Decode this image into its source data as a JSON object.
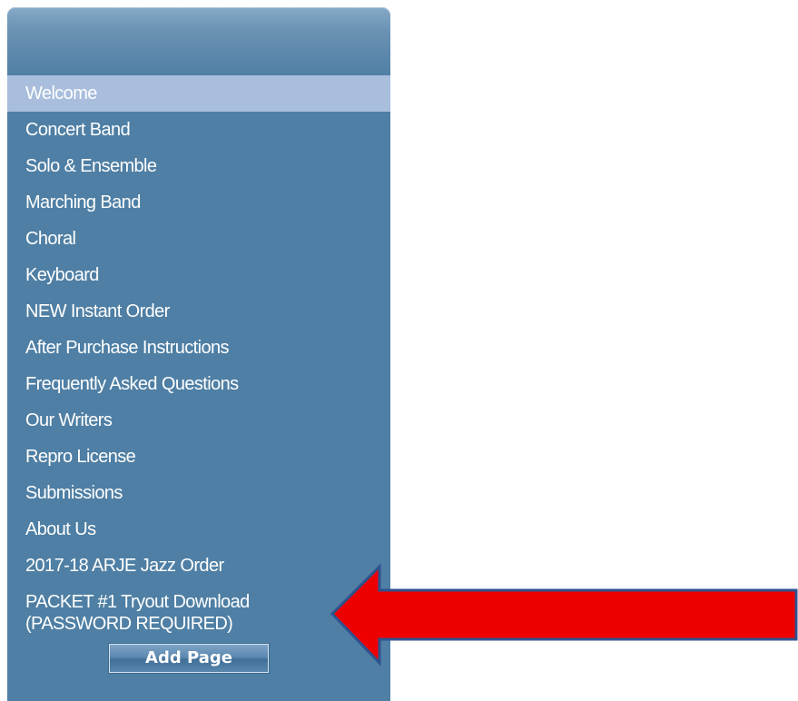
{
  "nav": {
    "items": [
      {
        "label": "Welcome",
        "active": true
      },
      {
        "label": "Concert Band"
      },
      {
        "label": "Solo & Ensemble"
      },
      {
        "label": "Marching Band"
      },
      {
        "label": "Choral"
      },
      {
        "label": "Keyboard"
      },
      {
        "label": "NEW Instant Order"
      },
      {
        "label": "After Purchase Instructions"
      },
      {
        "label": "Frequently Asked Questions"
      },
      {
        "label": "Our Writers"
      },
      {
        "label": "Repro License"
      },
      {
        "label": "Submissions"
      },
      {
        "label": "About Us"
      },
      {
        "label": "2017-18 ARJE Jazz Order"
      }
    ],
    "packet_item": {
      "line1": "PACKET #1 Tryout Download",
      "line2": "(PASSWORD REQUIRED)"
    },
    "add_page_label": "Add Page"
  },
  "colors": {
    "panel": "#4f7fa4",
    "active_item": "#a9bddd",
    "arrow_fill": "#ee0000",
    "arrow_stroke": "#2f528f"
  },
  "icons": {
    "pointer": "red-arrow-icon"
  }
}
